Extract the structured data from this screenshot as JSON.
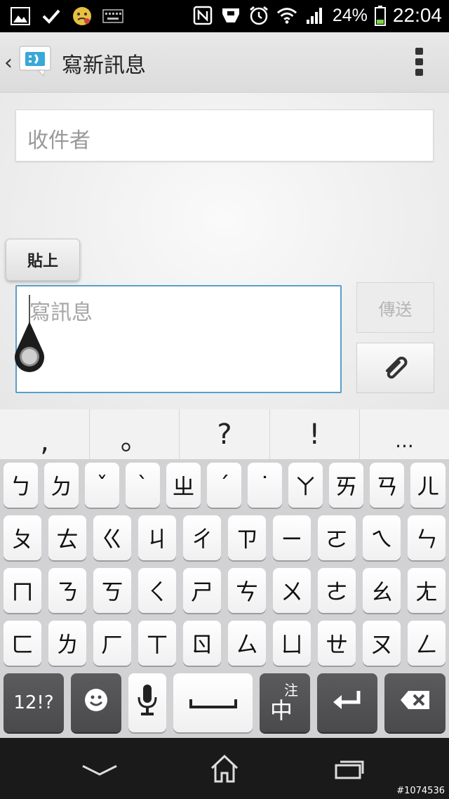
{
  "status_bar": {
    "battery_percent": "24%",
    "time": "22:04",
    "left_icons": [
      "image-icon",
      "check-icon",
      "emoji-face-icon",
      "keyboard-icon"
    ],
    "right_icons": [
      "nfc-icon",
      "usb-icon",
      "alarm-icon",
      "wifi-icon",
      "signal-icon",
      "battery-icon"
    ]
  },
  "action_bar": {
    "title": "寫新訊息"
  },
  "compose": {
    "recipient_placeholder": "收件者",
    "message_placeholder": "寫訊息",
    "paste_label": "貼上",
    "send_label": "傳送"
  },
  "keyboard": {
    "suggestions": [
      ",",
      "。",
      "?",
      "!",
      "..."
    ],
    "row1": [
      "ㄅ",
      "ㄉ",
      "ˇ",
      "ˋ",
      "ㄓ",
      "ˊ",
      "˙",
      "ㄚ",
      "ㄞ",
      "ㄢ",
      "ㄦ"
    ],
    "row2": [
      "ㄆ",
      "ㄊ",
      "ㄍ",
      "ㄐ",
      "ㄔ",
      "ㄗ",
      "ㄧ",
      "ㄛ",
      "ㄟ",
      "ㄣ"
    ],
    "row3": [
      "ㄇ",
      "ㄋ",
      "ㄎ",
      "ㄑ",
      "ㄕ",
      "ㄘ",
      "ㄨ",
      "ㄜ",
      "ㄠ",
      "ㄤ"
    ],
    "row4": [
      "ㄈ",
      "ㄌ",
      "ㄏ",
      "ㄒ",
      "ㄖ",
      "ㄙ",
      "ㄩ",
      "ㄝ",
      "ㄡ",
      "ㄥ"
    ],
    "symbols_key": "12!?",
    "lang_key_top": "注",
    "lang_key_main": "中"
  },
  "watermark": "#1074536"
}
